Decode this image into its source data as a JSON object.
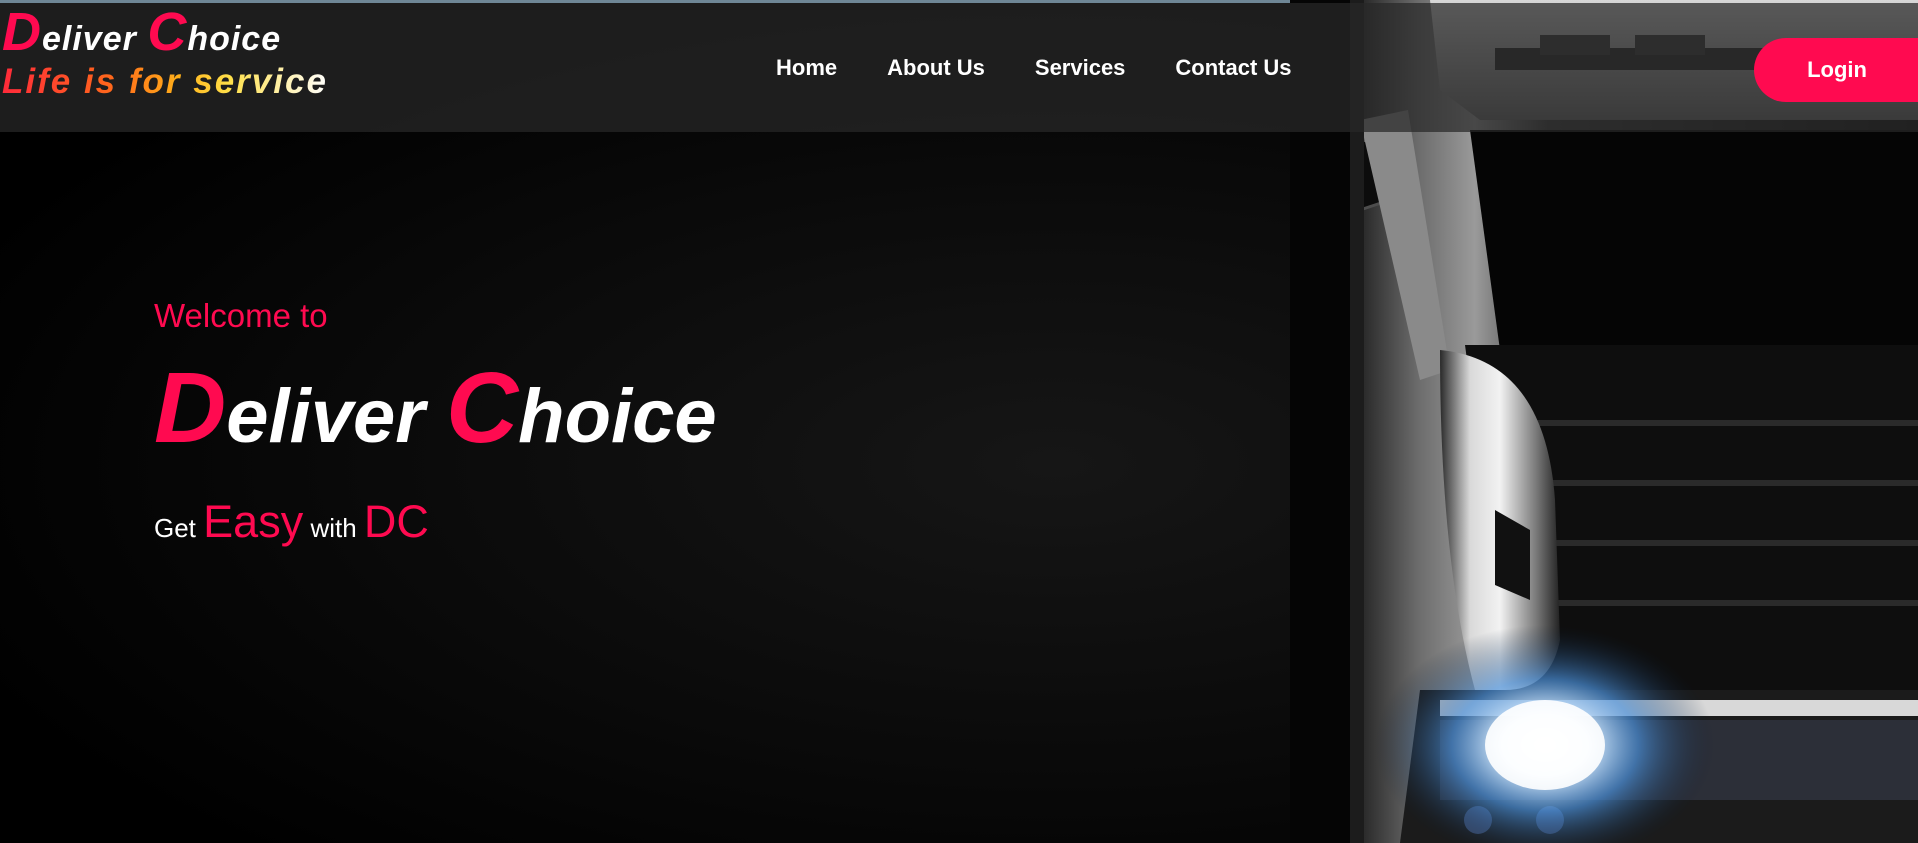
{
  "header": {
    "logo": {
      "title_cap_1": "D",
      "title_rest_1": "eliver ",
      "title_cap_2": "C",
      "title_rest_2": "hoice",
      "tagline": "Life is for service"
    },
    "nav": [
      {
        "label": "Home"
      },
      {
        "label": "About Us"
      },
      {
        "label": "Services"
      },
      {
        "label": "Contact Us"
      }
    ],
    "login_label": "Login"
  },
  "hero": {
    "welcome": "Welcome to",
    "brand_cap_1": "D",
    "brand_rest_1": "eliver ",
    "brand_cap_2": "C",
    "brand_rest_2": "hoice",
    "slogan_get": "Get",
    "slogan_easy": "Easy",
    "slogan_with": "with",
    "slogan_dc": "DC"
  },
  "colors": {
    "accent": "#ff0a50",
    "header_bg": "#282828",
    "background": "#000000",
    "text": "#ffffff"
  }
}
